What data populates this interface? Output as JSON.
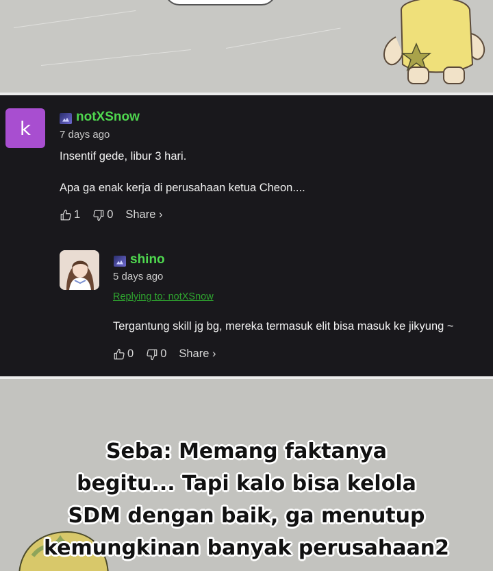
{
  "comments": [
    {
      "avatar_letter": "k",
      "username": "notXSnow",
      "time": "7 days ago",
      "lines": [
        "Insentif gede, libur 3 hari.",
        "Apa ga enak kerja di perusahaan ketua Cheon...."
      ],
      "likes": "1",
      "dislikes": "0",
      "share": "Share ›"
    },
    {
      "username": "shino",
      "time": "5 days ago",
      "reply_to": "Replying to: notXSnow",
      "lines": [
        "Tergantung skill jg bg, mereka termasuk elit bisa masuk ke jikyung ~"
      ],
      "likes": "0",
      "dislikes": "0",
      "share": "Share ›"
    }
  ],
  "manga_text": [
    "Seba: Memang faktanya",
    "begitu... Tapi kalo bisa kelola",
    "SDM dengan baik, ga menutup",
    "kemungkinan banyak perusahaan2"
  ],
  "colors": {
    "username": "#4fd84f",
    "reply_link": "#2fa52f",
    "avatar_k": "#a84ed0",
    "panel_bg": "#19181c"
  }
}
